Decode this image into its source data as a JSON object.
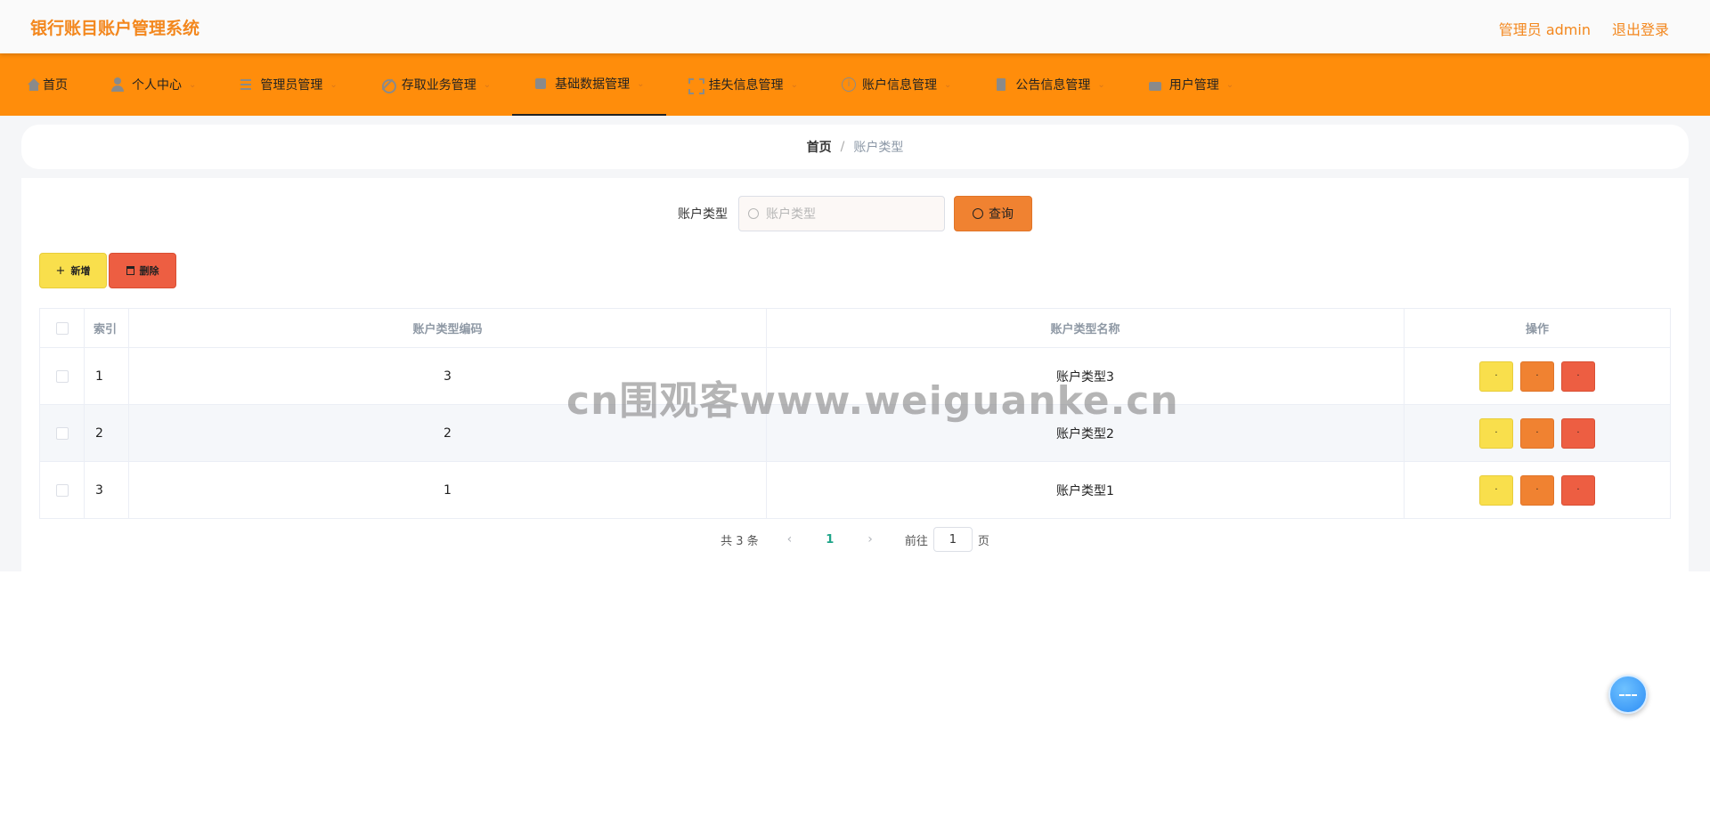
{
  "header": {
    "app_title": "银行账目账户管理系统",
    "admin_label": "管理员 admin",
    "logout_label": "退出登录"
  },
  "nav": {
    "items": [
      {
        "label": "首页",
        "icon": "home-icon",
        "has_dropdown": false
      },
      {
        "label": "个人中心",
        "icon": "user-icon",
        "has_dropdown": true
      },
      {
        "label": "管理员管理",
        "icon": "list-icon",
        "has_dropdown": true
      },
      {
        "label": "存取业务管理",
        "icon": "bell-off-icon",
        "has_dropdown": true
      },
      {
        "label": "基础数据管理",
        "icon": "box-icon",
        "has_dropdown": true,
        "active": true
      },
      {
        "label": "挂失信息管理",
        "icon": "frame-icon",
        "has_dropdown": true
      },
      {
        "label": "账户信息管理",
        "icon": "info-icon",
        "has_dropdown": true
      },
      {
        "label": "公告信息管理",
        "icon": "clipboard-icon",
        "has_dropdown": true
      },
      {
        "label": "用户管理",
        "icon": "thumb-icon",
        "has_dropdown": true
      }
    ]
  },
  "breadcrumb": {
    "home": "首页",
    "separator": "/",
    "current": "账户类型"
  },
  "search": {
    "label": "账户类型",
    "placeholder": "账户类型",
    "button_label": "查询"
  },
  "actions": {
    "add_label": "新增",
    "delete_label": "删除"
  },
  "table": {
    "headers": {
      "index": "索引",
      "code": "账户类型编码",
      "name": "账户类型名称",
      "ops": "操作"
    },
    "rows": [
      {
        "index": "1",
        "code": "3",
        "name": "账户类型3"
      },
      {
        "index": "2",
        "code": "2",
        "name": "账户类型2"
      },
      {
        "index": "3",
        "code": "1",
        "name": "账户类型1"
      }
    ],
    "op_label": "·"
  },
  "pagination": {
    "total_text": "共 3 条",
    "current_page": "1",
    "goto_label": "前往",
    "goto_value": "1",
    "page_suffix": "页"
  },
  "watermark": "cn围观客www.weiguanke.cn",
  "colors": {
    "accent": "#ff8d0b",
    "title": "#f3871d",
    "yellow": "#f9df4c",
    "orange": "#f08231",
    "red": "#ed5e42",
    "page_active": "#1fa589"
  }
}
